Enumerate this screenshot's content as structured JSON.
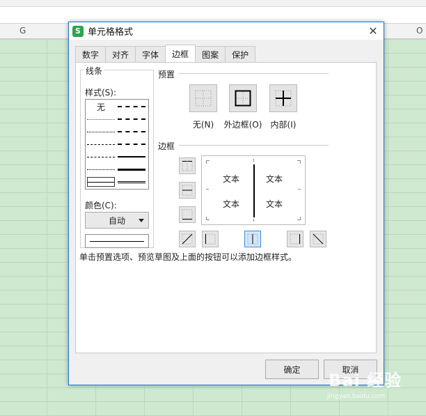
{
  "spreadsheet": {
    "columns": [
      "G",
      "O"
    ]
  },
  "dialog": {
    "title": "单元格格式",
    "app_icon_letter": "S",
    "close_glyph": "✕",
    "tabs": [
      {
        "label": "数字"
      },
      {
        "label": "对齐"
      },
      {
        "label": "字体"
      },
      {
        "label": "边框",
        "active": true
      },
      {
        "label": "图案"
      },
      {
        "label": "保护"
      }
    ],
    "line_group": {
      "title": "线条",
      "style_label": "样式(S):",
      "none_label": "无",
      "color_label": "颜色(C):",
      "color_value": "自动"
    },
    "preset": {
      "title": "预置",
      "buttons": [
        {
          "label": "无(N)"
        },
        {
          "label": "外边框(O)"
        },
        {
          "label": "内部(I)"
        }
      ]
    },
    "border": {
      "title": "边框",
      "preview_text": [
        "文本",
        "文本",
        "文本",
        "文本"
      ]
    },
    "hint": "单击预置选项、预览草图及上面的按钮可以添加边框样式。",
    "ok_label": "确定",
    "cancel_label": "取消"
  },
  "watermark": {
    "main": "Bai 经验",
    "sub": "jingyan.baidu.com"
  },
  "colors": {
    "accent": "#1a76d2",
    "sheet_bg": "#cfe8d0",
    "active_toggle": "#d3e6f8"
  }
}
